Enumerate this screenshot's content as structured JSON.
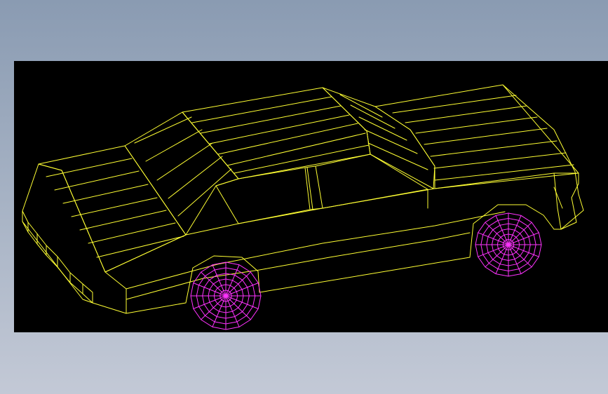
{
  "scene": {
    "background_color": "#000000",
    "body_wire_color": "#ffff33",
    "wheel_wire_color": "#ff33ff",
    "wheels": [
      {
        "name": "front-wheel",
        "rings": 6,
        "spokes": 16
      },
      {
        "name": "rear-wheel",
        "rings": 6,
        "spokes": 16
      }
    ]
  }
}
